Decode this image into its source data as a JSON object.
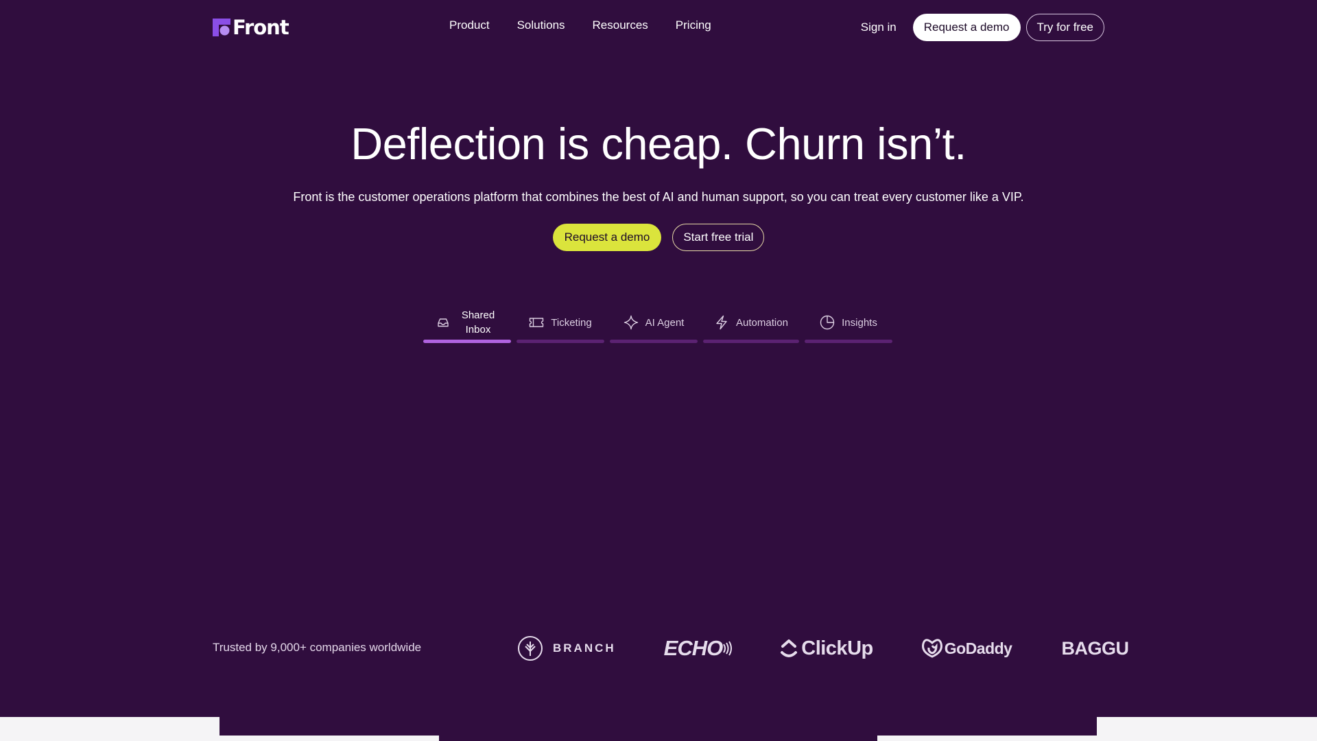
{
  "brand": {
    "logo_text": "Front",
    "accent": "#8a4ee6",
    "background": "#300d3e",
    "cta_lime": "#dbe43c",
    "tab_active_bar": "#b063e0"
  },
  "nav": {
    "links": [
      "Product",
      "Solutions",
      "Resources",
      "Pricing"
    ],
    "sign_in": "Sign in",
    "request_demo": "Request a demo",
    "try_free": "Try for free"
  },
  "hero": {
    "title": "Deflection is cheap. Churn isn’t.",
    "subtitle": "Front is the customer operations platform that combines the best of AI and human support, so you can treat every customer like a VIP.",
    "primary_cta": "Request a demo",
    "secondary_cta": "Start free trial"
  },
  "tabs": [
    {
      "label": "Shared Inbox",
      "icon": "inbox-icon",
      "active": true
    },
    {
      "label": "Ticketing",
      "icon": "ticket-icon",
      "active": false
    },
    {
      "label": "AI Agent",
      "icon": "sparkle-icon",
      "active": false
    },
    {
      "label": "Automation",
      "icon": "lightning-icon",
      "active": false
    },
    {
      "label": "Insights",
      "icon": "pie-chart-icon",
      "active": false
    }
  ],
  "trusted": {
    "text": "Trusted by 9,000+ companies worldwide",
    "logos": [
      "BRANCH",
      "ECHO",
      "ClickUp",
      "GoDaddy",
      "BAGGU"
    ]
  }
}
